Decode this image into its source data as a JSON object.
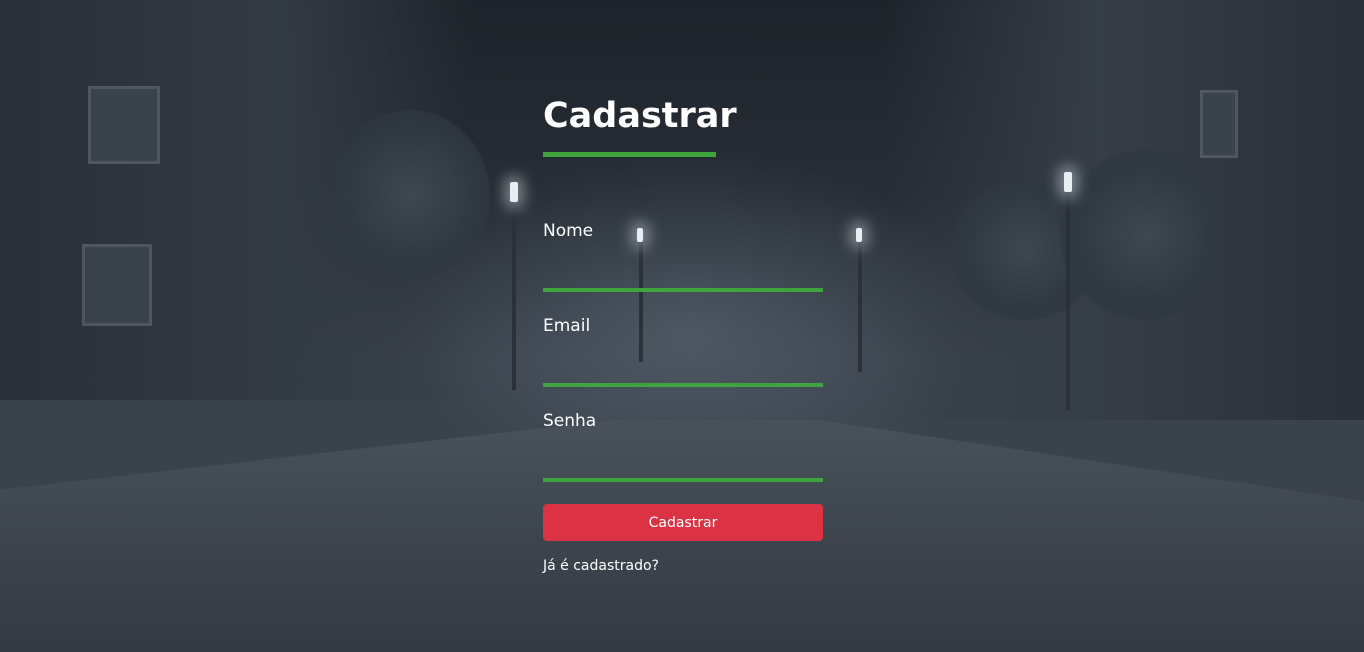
{
  "form": {
    "title": "Cadastrar",
    "fields": [
      {
        "label": "Nome",
        "value": ""
      },
      {
        "label": "Email",
        "value": ""
      },
      {
        "label": "Senha",
        "value": ""
      }
    ],
    "submit_label": "Cadastrar",
    "login_link_label": "Já é cadastrado?"
  },
  "colors": {
    "accent": "#3fa43c",
    "button": "#dc3344"
  }
}
